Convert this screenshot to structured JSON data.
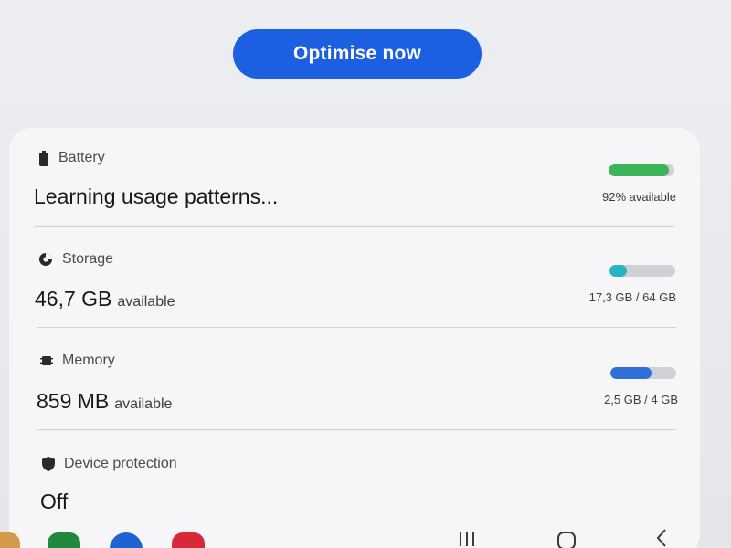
{
  "actions": {
    "optimise_label": "Optimise now"
  },
  "battery": {
    "label": "Battery",
    "status": "Learning usage patterns...",
    "detail": "92% available",
    "level": 0.92,
    "bar_color": "#3cb55a"
  },
  "storage": {
    "label": "Storage",
    "value": "46,7 GB",
    "unit": "available",
    "detail": "17,3 GB / 64 GB",
    "level": 0.27,
    "bar_color": "#27b4c4"
  },
  "memory": {
    "label": "Memory",
    "value": "859 MB",
    "unit": "available",
    "detail": "2,5 GB / 4 GB",
    "level": 0.625,
    "bar_color": "#2f6fd6"
  },
  "device_protection": {
    "label": "Device protection",
    "status": "Off"
  },
  "nav": {
    "icons": [
      "recent-apps-icon",
      "home-icon",
      "back-icon"
    ]
  },
  "colors": {
    "accent": "#1c5fe0",
    "card_bg": "#f6f6f8",
    "page_bg": "#e7e8ec"
  }
}
